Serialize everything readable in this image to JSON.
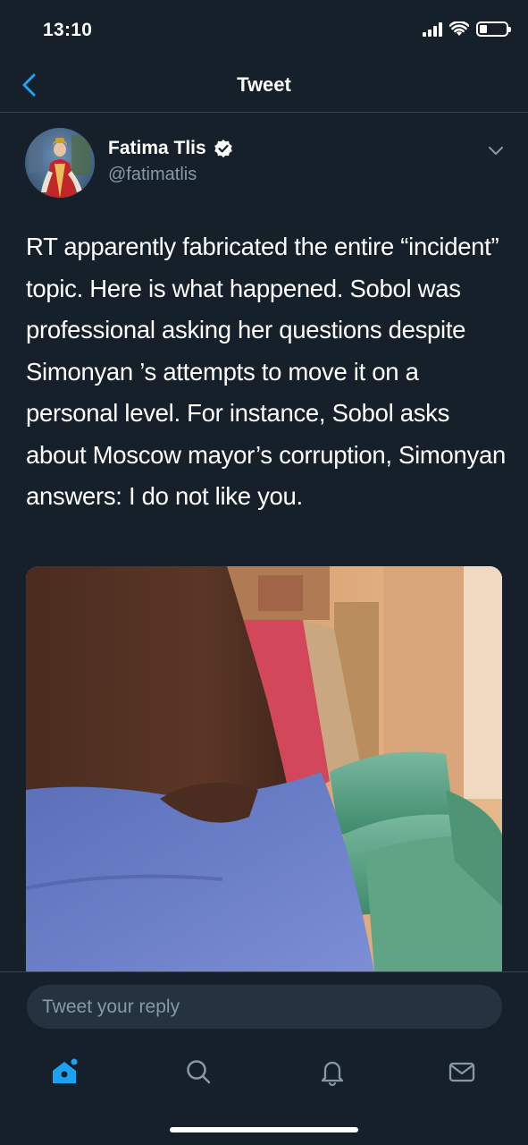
{
  "status_bar": {
    "time": "13:10"
  },
  "nav": {
    "title": "Tweet",
    "back_icon": "chevron-left-icon"
  },
  "tweet": {
    "author_name": "Fatima Tlis",
    "author_handle": "@fatimatlis",
    "verified": true,
    "text": "RT apparently fabricated the entire “incident” topic. Here is what happened. Sobol was  professional asking her questions despite Simonyan ’s attempts to move it on a personal level. For instance, Sobol asks about Moscow mayor’s corruption, Simonyan answers: I do not like you."
  },
  "reply": {
    "placeholder": "Tweet your reply"
  },
  "tab_bar": {
    "items": [
      {
        "name": "home",
        "icon": "home-icon",
        "active": true
      },
      {
        "name": "search",
        "icon": "search-icon",
        "active": false
      },
      {
        "name": "notifications",
        "icon": "bell-icon",
        "active": false
      },
      {
        "name": "messages",
        "icon": "mail-icon",
        "active": false
      }
    ]
  },
  "colors": {
    "background": "#15202b",
    "accent": "#1da1f2",
    "secondary_text": "#8899a6",
    "divider": "#38444d",
    "input_background": "#253341"
  }
}
